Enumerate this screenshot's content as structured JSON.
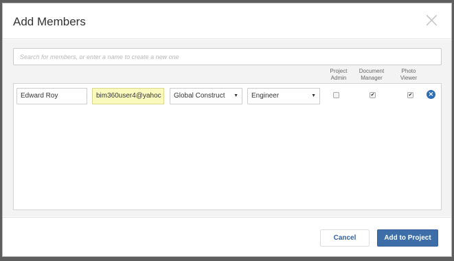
{
  "dialog": {
    "title": "Add Members",
    "close_glyph": "×"
  },
  "search": {
    "placeholder": "Search for members, or enter a name to create a new one",
    "value": ""
  },
  "columns": {
    "project_admin": [
      "Project",
      "Admin"
    ],
    "document_manager": [
      "Document",
      "Manager"
    ],
    "photo_viewer": [
      "Photo",
      "Viewer"
    ]
  },
  "member": {
    "name": "Edward Roy",
    "email": "bim360user4@yahoc",
    "company": "Global Construct",
    "role": "Engineer",
    "project_admin": false,
    "document_manager": true,
    "photo_viewer": true
  },
  "footer": {
    "cancel_label": "Cancel",
    "add_label": "Add to Project"
  },
  "icons": {
    "close": "close-icon",
    "remove": "remove-member-icon",
    "dropdown": "caret-down-icon"
  },
  "colors": {
    "primary": "#3d6ea7",
    "email_highlight": "#fafabf",
    "remove_icon": "#2f6db5"
  }
}
